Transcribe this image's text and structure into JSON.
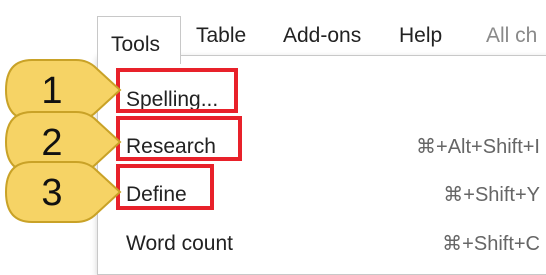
{
  "menubar": {
    "tools": "Tools",
    "table": "Table",
    "addons": "Add-ons",
    "help": "Help",
    "all_changes": "All ch"
  },
  "menu": {
    "items": [
      {
        "label": "Spelling...",
        "shortcut": ""
      },
      {
        "label": "Research",
        "shortcut": "⌘+Alt+Shift+I"
      },
      {
        "label": "Define",
        "shortcut": "⌘+Shift+Y"
      },
      {
        "label": "Word count",
        "shortcut": "⌘+Shift+C"
      }
    ]
  },
  "callouts": [
    "1",
    "2",
    "3"
  ],
  "colors": {
    "highlight": "#e8212a",
    "callout_fill": "#f6d365",
    "callout_stroke": "#c9a227"
  }
}
